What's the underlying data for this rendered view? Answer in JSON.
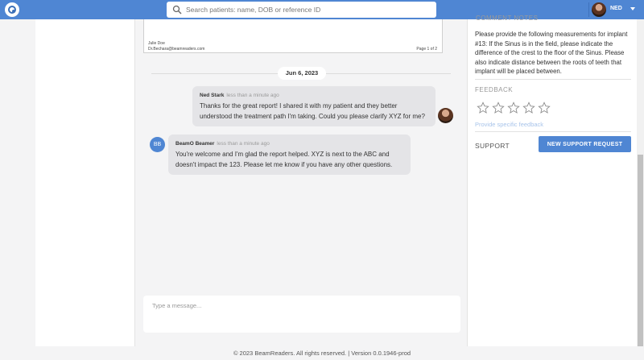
{
  "header": {
    "search_placeholder": "Search patients: name, DOB or reference ID",
    "user_name": "NED"
  },
  "report": {
    "name": "Julie Doe",
    "email": "Dr.Bechara@beamreaders.com",
    "page": "Page 1 of 2"
  },
  "chat": {
    "date": "Jun 6, 2023",
    "messages": [
      {
        "author": "Ned Stark",
        "time": "less than a minute ago",
        "text": "Thanks for the great report! I shared it with my patient and they better understood the treatment path I'm taking. Could you please clarify XYZ for me?"
      },
      {
        "author": "BeamO Beamer",
        "time": "less than a minute ago",
        "text": "You're welcome and I'm glad the report helped. XYZ is next to the ABC and doesn't impact the 123. Please let me know if you have any other questions.",
        "initials": "BB"
      }
    ],
    "input_placeholder": "Type a message..."
  },
  "panel": {
    "comment_section_title": "COMMENT NOTES",
    "comment": "Please provide the following measurements for implant #13: If the Sinus is in the field, please indicate the difference of the crest to the floor of the Sinus. Please also indicate distance between the roots of teeth that implant will be placed between.",
    "feedback_title": "FEEDBACK",
    "rating": 0,
    "rating_max": 5,
    "feedback_link": "Provide specific feedback",
    "support_title": "SUPPORT",
    "support_button": "NEW SUPPORT REQUEST"
  },
  "footer": {
    "text": "© 2023 BeamReaders. All rights reserved.   |   Version 0.0.1946-prod"
  },
  "colors": {
    "brand": "#4f86d3",
    "bubble": "#e4e4e7",
    "link": "#a8c4ea"
  }
}
